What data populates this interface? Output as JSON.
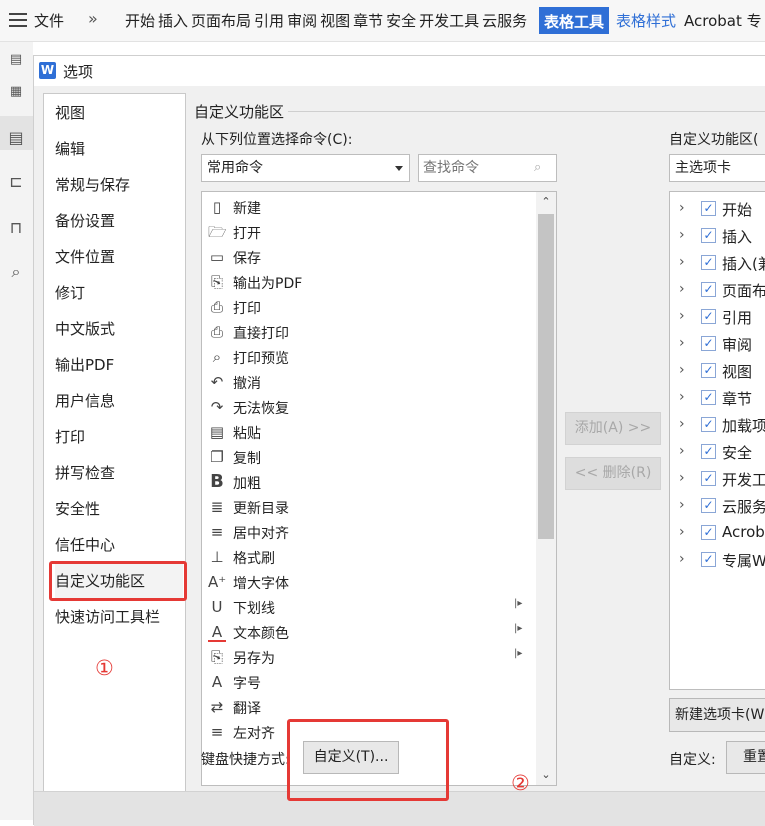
{
  "ribbon": {
    "file": "文件",
    "chevron": "»",
    "tabs": [
      "开始",
      "插入",
      "页面布局",
      "引用",
      "审阅",
      "视图",
      "章节",
      "安全",
      "开发工具",
      "云服务"
    ],
    "table_tools": "表格工具",
    "table_style": "表格样式",
    "acrobat": "Acrobat 专"
  },
  "dialog": {
    "logo": "W",
    "title": "选项",
    "nav": [
      "视图",
      "编辑",
      "常规与保存",
      "备份设置",
      "文件位置",
      "修订",
      "中文版式",
      "输出PDF",
      "用户信息",
      "打印",
      "拼写检查",
      "安全性",
      "信任中心",
      "自定义功能区",
      "快速访问工具栏"
    ],
    "active_nav": "自定义功能区",
    "section_title": "自定义功能区",
    "choose_from_label": "从下列位置选择命令(C):",
    "choose_from_value": "常用命令",
    "search_placeholder": "查找命令",
    "commands": [
      {
        "label": "新建",
        "icon": "new-document-icon",
        "glyph": "▯"
      },
      {
        "label": "打开",
        "icon": "open-folder-icon",
        "glyph": "🗁"
      },
      {
        "label": "保存",
        "icon": "save-icon",
        "glyph": "▭"
      },
      {
        "label": "输出为PDF",
        "icon": "export-pdf-icon",
        "glyph": "⎘"
      },
      {
        "label": "打印",
        "icon": "print-icon",
        "glyph": "⎙"
      },
      {
        "label": "直接打印",
        "icon": "direct-print-icon",
        "glyph": "⎙"
      },
      {
        "label": "打印预览",
        "icon": "print-preview-icon",
        "glyph": "⌕"
      },
      {
        "label": "撤消",
        "icon": "undo-icon",
        "glyph": "↶"
      },
      {
        "label": "无法恢复",
        "icon": "redo-icon",
        "glyph": "↷"
      },
      {
        "label": "粘贴",
        "icon": "paste-icon",
        "glyph": "▤"
      },
      {
        "label": "复制",
        "icon": "copy-icon",
        "glyph": "❐"
      },
      {
        "label": "加粗",
        "icon": "bold-icon",
        "glyph": "B"
      },
      {
        "label": "更新目录",
        "icon": "update-toc-icon",
        "glyph": "≣"
      },
      {
        "label": "居中对齐",
        "icon": "align-center-icon",
        "glyph": "≡"
      },
      {
        "label": "格式刷",
        "icon": "format-painter-icon",
        "glyph": "⊥"
      },
      {
        "label": "增大字体",
        "icon": "increase-font-icon",
        "glyph": "A⁺"
      },
      {
        "label": "下划线",
        "icon": "underline-icon",
        "glyph": "U"
      },
      {
        "label": "文本颜色",
        "icon": "text-color-icon",
        "glyph": "A"
      },
      {
        "label": "另存为",
        "icon": "save-as-icon",
        "glyph": "⎘"
      },
      {
        "label": "字号",
        "icon": "font-size-icon",
        "glyph": "A"
      },
      {
        "label": "翻译",
        "icon": "translate-icon",
        "glyph": "⇄"
      },
      {
        "label": "左对齐",
        "icon": "align-left-icon",
        "glyph": "≡"
      }
    ],
    "commands_with_submenu": [
      "下划线",
      "文本颜色",
      "另存为"
    ],
    "add_button": "添加(A) >>",
    "remove_button": "<< 删除(R)",
    "right_label": "自定义功能区(",
    "tab_select_value": "主选项卡",
    "ribbon_tabs": [
      "开始",
      "插入",
      "插入(兼",
      "页面布",
      "引用",
      "审阅",
      "视图",
      "章节",
      "加载项",
      "安全",
      "开发工",
      "云服务",
      "Acrob",
      "专属W"
    ],
    "new_tab_button": "新建选项卡(W",
    "shortcut_label": "键盘快捷方式:",
    "customize_button": "自定义(T)...",
    "custom_label": "自定义:",
    "reset_button": "重置"
  },
  "annotations": {
    "one": "①",
    "two": "②",
    "color": "#e53935"
  },
  "colors": {
    "accent": "#2f6fd6"
  }
}
